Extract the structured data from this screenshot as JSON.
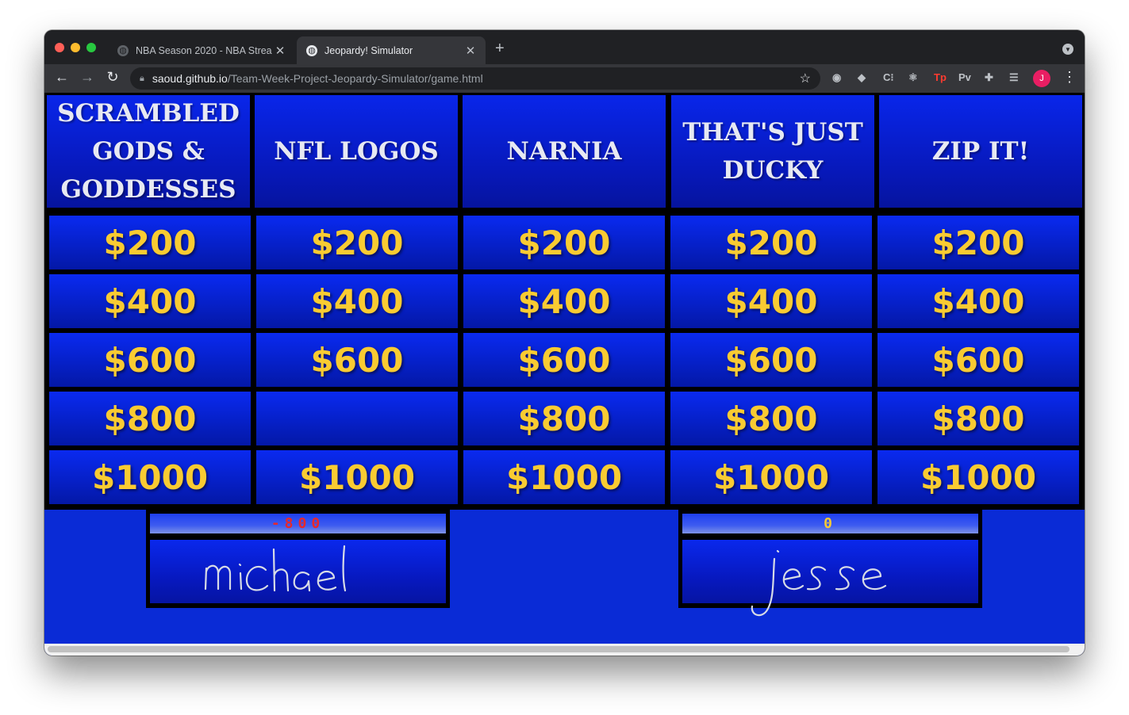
{
  "browser": {
    "tabs": [
      {
        "title": "NBA Season 2020 - NBA Strea",
        "active": false
      },
      {
        "title": "Jeopardy! Simulator",
        "active": true
      }
    ],
    "new_tab_label": "+",
    "url_host": "saoud.github.io",
    "url_path": "/Team-Week-Project-Jeopardy-Simulator/game.html",
    "extensions": [
      "Tp",
      "Pv"
    ],
    "avatar_initial": "J"
  },
  "board": {
    "categories": [
      {
        "title": "SCRAMBLED GODS & GODDESSES",
        "values": [
          "$200",
          "$400",
          "$600",
          "$800",
          "$1000"
        ]
      },
      {
        "title": "NFL LOGOS",
        "values": [
          "$200",
          "$400",
          "$600",
          "",
          "$1000"
        ]
      },
      {
        "title": "NARNIA",
        "values": [
          "$200",
          "$400",
          "$600",
          "$800",
          "$1000"
        ]
      },
      {
        "title": "THAT'S JUST DUCKY",
        "values": [
          "$200",
          "$400",
          "$600",
          "$800",
          "$1000"
        ]
      },
      {
        "title": "ZIP IT!",
        "values": [
          "$200",
          "$400",
          "$600",
          "$800",
          "$1000"
        ]
      }
    ]
  },
  "players": [
    {
      "name": "michael",
      "score": "-800",
      "score_color": "#e8282a"
    },
    {
      "name": "jesse",
      "score": "0",
      "score_color": "#f9cb32"
    }
  ],
  "colors": {
    "board_blue": "#0a2bd6",
    "value_gold": "#f9cb32"
  }
}
